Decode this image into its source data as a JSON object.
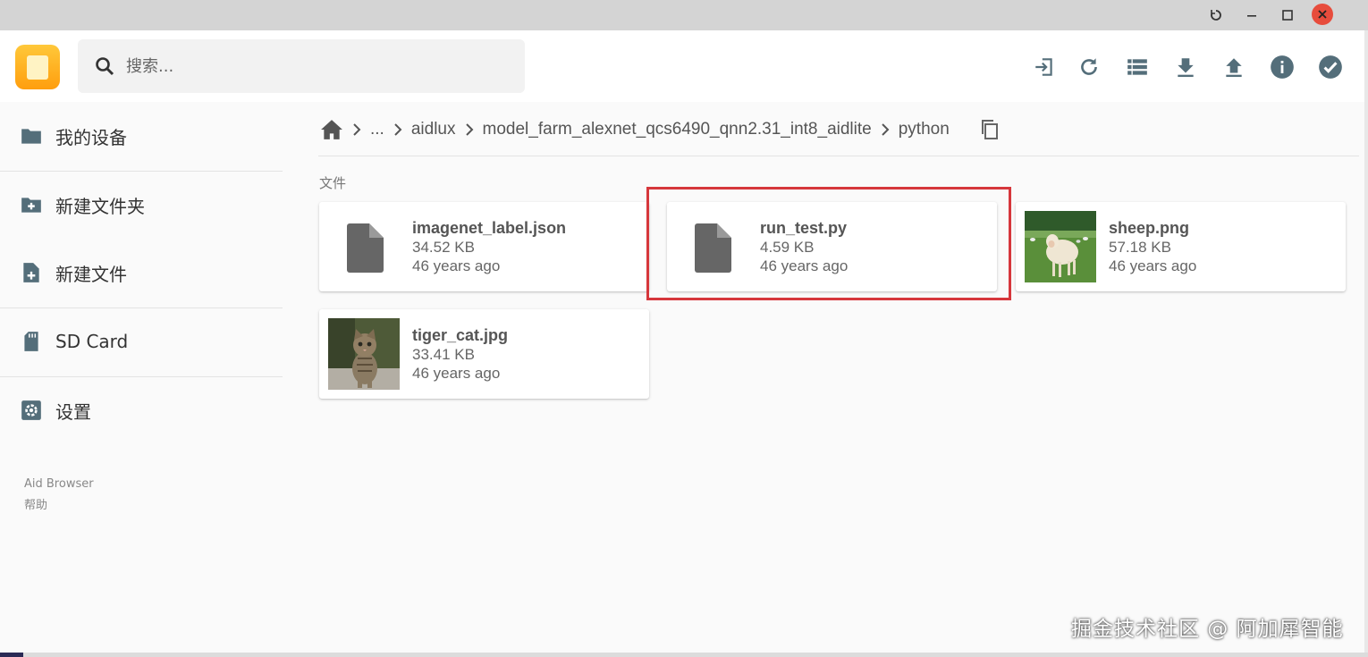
{
  "search": {
    "placeholder": "搜索..."
  },
  "toolbar": [
    {
      "name": "open-icon"
    },
    {
      "name": "refresh-icon"
    },
    {
      "name": "list-view-icon"
    },
    {
      "name": "download-icon"
    },
    {
      "name": "upload-icon"
    },
    {
      "name": "info-icon"
    },
    {
      "name": "select-all-icon"
    }
  ],
  "sidebar": {
    "items": [
      {
        "label": "我的设备",
        "icon": "folder-icon"
      },
      {
        "label": "新建文件夹",
        "icon": "new-folder-icon"
      },
      {
        "label": "新建文件",
        "icon": "new-file-icon"
      },
      {
        "label": "SD Card",
        "icon": "sd-card-icon"
      },
      {
        "label": "设置",
        "icon": "settings-icon"
      }
    ],
    "footer": [
      "Aid Browser",
      "帮助"
    ]
  },
  "breadcrumb": {
    "items": [
      "...",
      "aidlux",
      "model_farm_alexnet_qcs6490_qnn2.31_int8_aidlite",
      "python"
    ]
  },
  "files_section_label": "文件",
  "files": [
    {
      "name": "imagenet_label.json",
      "size": "34.52 KB",
      "date": "46 years ago",
      "thumb": "file-icon"
    },
    {
      "name": "run_test.py",
      "size": "4.59 KB",
      "date": "46 years ago",
      "thumb": "file-icon"
    },
    {
      "name": "sheep.png",
      "size": "57.18 KB",
      "date": "46 years ago",
      "thumb": "sheep-image"
    },
    {
      "name": "tiger_cat.jpg",
      "size": "33.41 KB",
      "date": "46 years ago",
      "thumb": "kitten-image"
    }
  ],
  "colors": {
    "accent": "#ffb21e",
    "icon": "#546e7a",
    "highlight": "#d6373c"
  },
  "watermark": "掘金技术社区 @ 阿加犀智能"
}
